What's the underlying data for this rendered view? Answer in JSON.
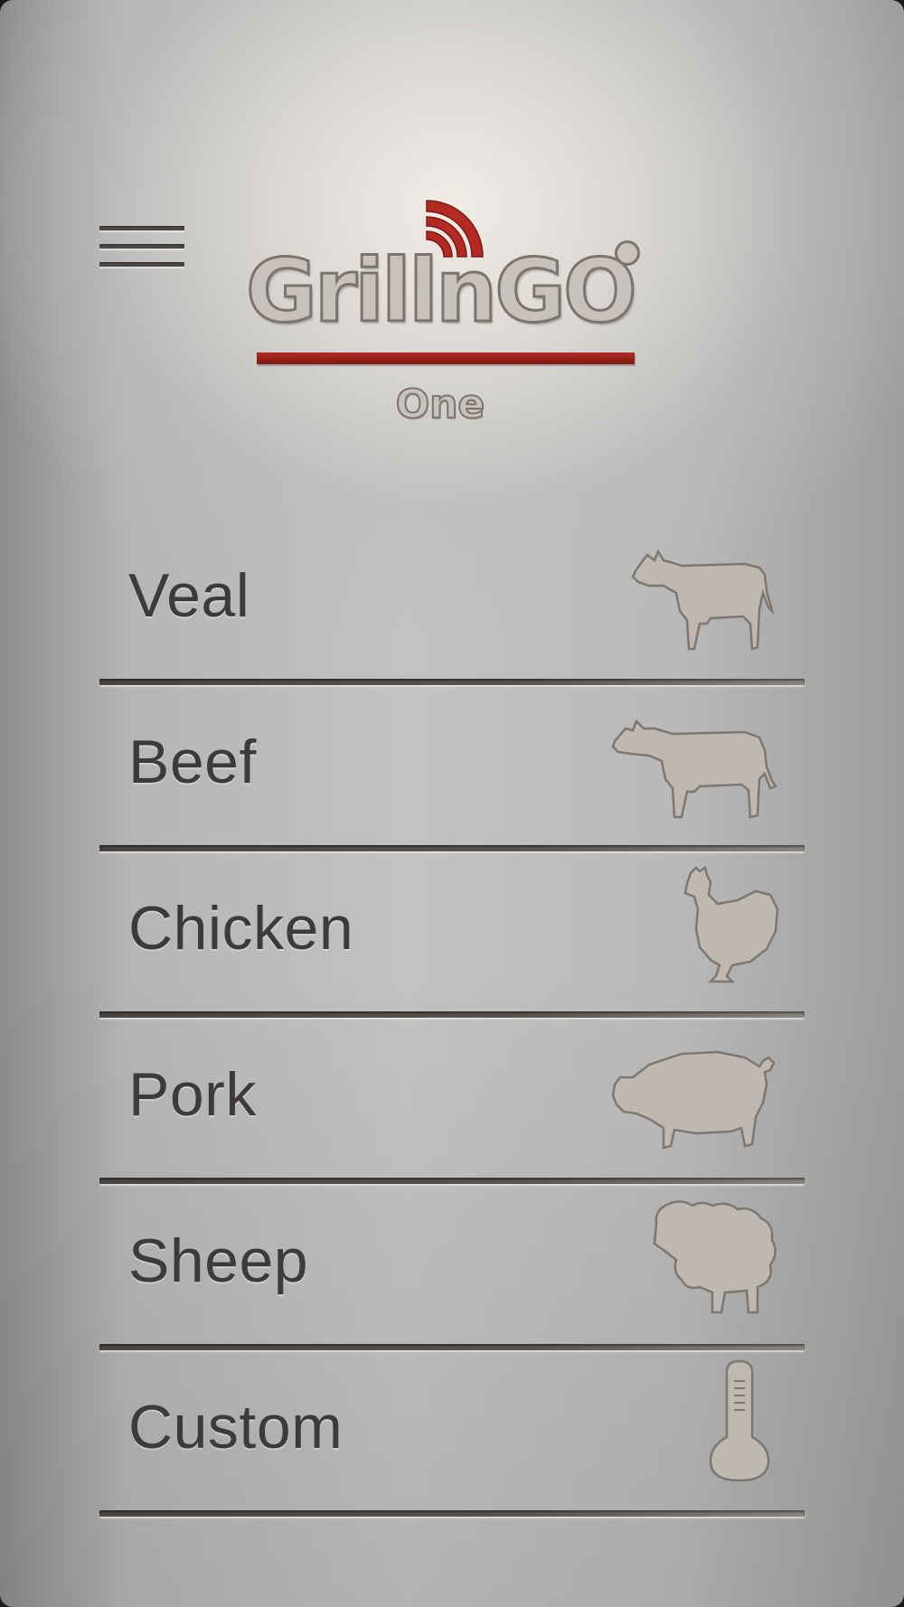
{
  "app": {
    "logo_text": "GrillnGO",
    "logo_subtitle": "One",
    "accent_color": "#b32a22"
  },
  "menu": {
    "icon": "hamburger-menu-icon"
  },
  "categories": [
    {
      "label": "Veal",
      "icon": "calf-icon"
    },
    {
      "label": "Beef",
      "icon": "cow-icon"
    },
    {
      "label": "Chicken",
      "icon": "chicken-icon"
    },
    {
      "label": "Pork",
      "icon": "pig-icon"
    },
    {
      "label": "Sheep",
      "icon": "sheep-icon"
    },
    {
      "label": "Custom",
      "icon": "thermometer-icon"
    }
  ]
}
